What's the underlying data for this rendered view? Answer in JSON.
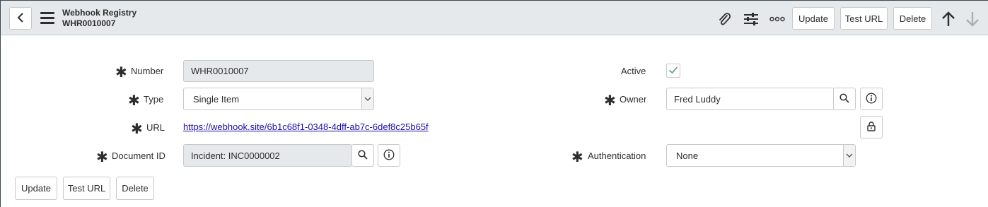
{
  "header": {
    "title": "Webhook Registry",
    "record_number": "WHR0010007",
    "update_label": "Update",
    "test_url_label": "Test URL",
    "delete_label": "Delete",
    "icons": [
      "back-icon",
      "menu-icon",
      "paperclip-icon",
      "sliders-icon",
      "more-icon",
      "arrow-up-icon",
      "arrow-down-icon"
    ]
  },
  "form": {
    "number": {
      "label": "Number",
      "value": "WHR0010007",
      "required": true
    },
    "type": {
      "label": "Type",
      "value": "Single Item",
      "required": true
    },
    "url": {
      "label": "URL",
      "value": "https://webhook.site/6b1c68f1-0348-4dff-ab7c-6def8c25b65f",
      "required": true
    },
    "document_id": {
      "label": "Document ID",
      "value": "Incident: INC0000002",
      "required": true
    },
    "active": {
      "label": "Active",
      "checked": true
    },
    "owner": {
      "label": "Owner",
      "value": "Fred Luddy",
      "required": true
    },
    "authentication": {
      "label": "Authentication",
      "value": "None",
      "required": true
    }
  },
  "footer": {
    "update_label": "Update",
    "test_url_label": "Test URL",
    "delete_label": "Delete"
  },
  "colors": {
    "header_bg": "#e5e9ec",
    "readonly_bg": "#e6e9eb",
    "link": "#1a0dab",
    "check": "#6aa38a"
  }
}
